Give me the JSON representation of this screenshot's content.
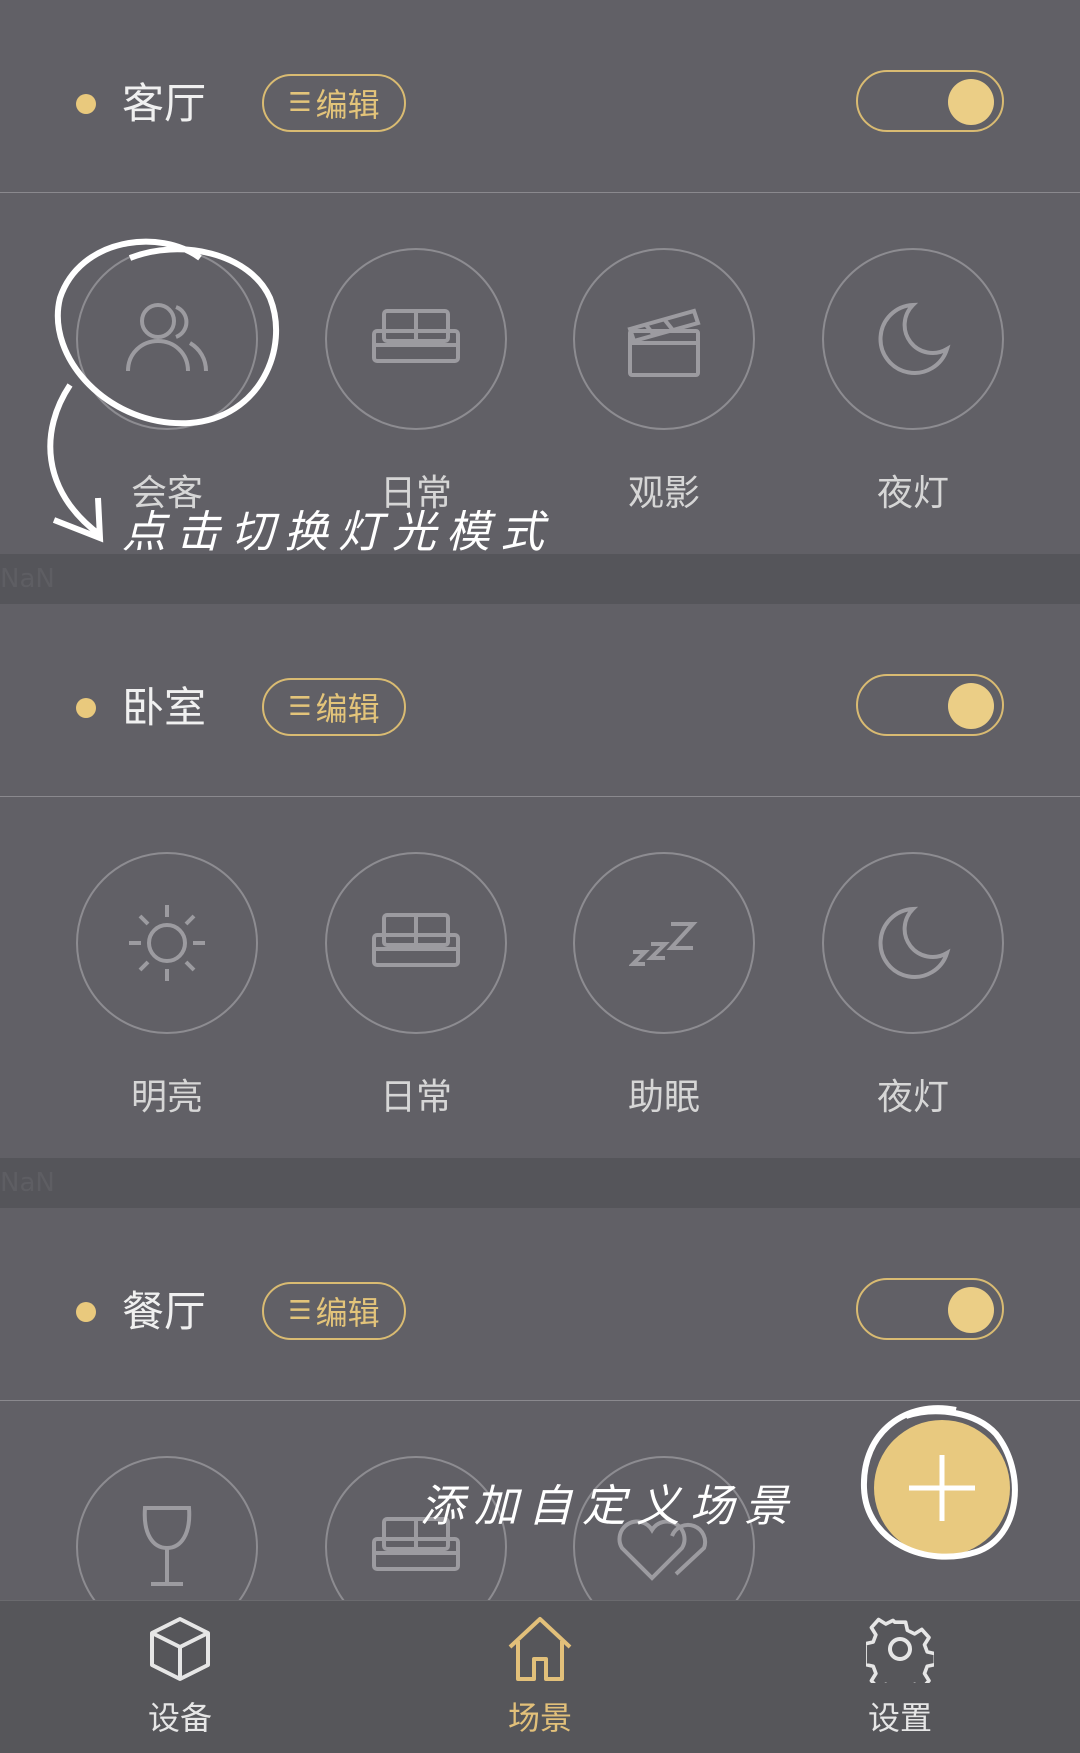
{
  "rooms": [
    {
      "title": "客厅",
      "edit_label": "编辑",
      "scenes": [
        {
          "label": "会客",
          "icon": "people-icon"
        },
        {
          "label": "日常",
          "icon": "sofa-icon"
        },
        {
          "label": "观影",
          "icon": "clapperboard-icon"
        },
        {
          "label": "夜灯",
          "icon": "moon-icon"
        }
      ]
    },
    {
      "title": "卧室",
      "edit_label": "编辑",
      "scenes": [
        {
          "label": "明亮",
          "icon": "sun-icon"
        },
        {
          "label": "日常",
          "icon": "sofa-icon"
        },
        {
          "label": "助眠",
          "icon": "sleep-zzz-icon"
        },
        {
          "label": "夜灯",
          "icon": "moon-icon"
        }
      ]
    },
    {
      "title": "餐厅",
      "edit_label": "编辑",
      "scenes": [
        {
          "label": "",
          "icon": "wine-glass-icon"
        },
        {
          "label": "",
          "icon": "sofa-icon"
        },
        {
          "label": "",
          "icon": "hearts-icon"
        }
      ]
    }
  ],
  "separators": [
    "NaN",
    "NaN"
  ],
  "annotations": {
    "tap_hint": "点击切换灯光模式",
    "add_hint": "添加自定义场景"
  },
  "tabbar": {
    "tabs": [
      {
        "label": "设备",
        "icon": "cube-icon",
        "active": false
      },
      {
        "label": "场景",
        "icon": "home-icon",
        "active": true
      },
      {
        "label": "设置",
        "icon": "gear-icon",
        "active": false
      }
    ]
  },
  "colors": {
    "background": "#616066",
    "accent": "#e8c97f",
    "tabbar": "#56565a"
  }
}
